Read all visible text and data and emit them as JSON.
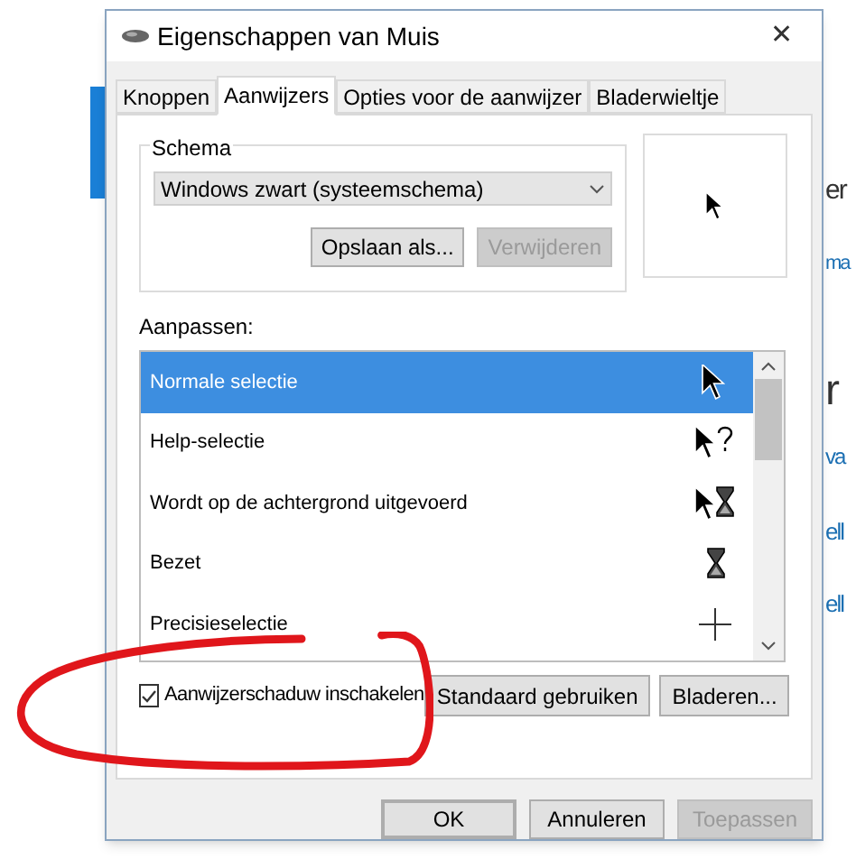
{
  "background_fragments": [
    {
      "text": "er",
      "kind": "heading"
    },
    {
      "text": "ma",
      "kind": "link"
    },
    {
      "text": "r",
      "kind": "heading"
    },
    {
      "text": "va",
      "kind": "link"
    },
    {
      "text": "ell",
      "kind": "link"
    },
    {
      "text": "ell",
      "kind": "link"
    }
  ],
  "window": {
    "title": "Eigenschappen van Muis",
    "close": "✕"
  },
  "tabs": [
    {
      "label": "Knoppen",
      "selected": false
    },
    {
      "label": "Aanwijzers",
      "selected": true
    },
    {
      "label": "Opties voor de aanwijzer",
      "selected": false
    },
    {
      "label": "Bladerwieltje",
      "selected": false
    }
  ],
  "schema": {
    "legend": "Schema",
    "value": "Windows zwart (systeemschema)",
    "buttons": [
      {
        "label": "Opslaan als...",
        "disabled": false
      },
      {
        "label": "Verwijderen",
        "disabled": true
      }
    ]
  },
  "customize": {
    "label": "Aanpassen:",
    "items": [
      {
        "label": "Normale selectie",
        "selected": true,
        "kind": "arrow"
      },
      {
        "label": "Help-selectie",
        "selected": false,
        "kind": "help"
      },
      {
        "label": "Wordt op de achtergrond uitgevoerd",
        "selected": false,
        "kind": "working"
      },
      {
        "label": "Bezet",
        "selected": false,
        "kind": "busy"
      },
      {
        "label": "Precisieselectie",
        "selected": false,
        "kind": "cross"
      }
    ]
  },
  "shadow": {
    "label": "Aanwijzerschaduw inschakelen",
    "checked": true
  },
  "list_buttons": [
    {
      "label": "Standaard gebruiken",
      "disabled": false
    },
    {
      "label": "Bladeren...",
      "disabled": false
    }
  ],
  "footer_buttons": [
    {
      "label": "OK",
      "disabled": false,
      "default": true
    },
    {
      "label": "Annuleren",
      "disabled": false,
      "default": false
    },
    {
      "label": "Toepassen",
      "disabled": true,
      "default": false
    }
  ]
}
